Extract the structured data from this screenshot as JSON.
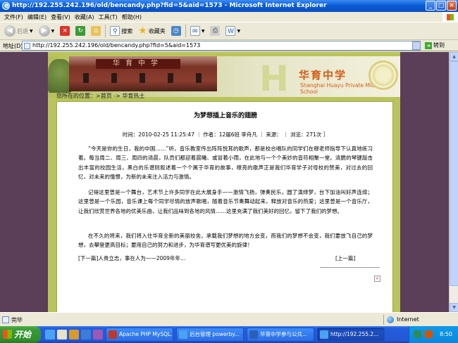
{
  "window": {
    "title": "http://192.255.242.196/old/bencandy.php?fid=5&aid=1573 - Microsoft Internet Explorer"
  },
  "menu": [
    "文件(F)",
    "编辑(E)",
    "查看(V)",
    "收藏(A)",
    "工具(T)",
    "帮助(H)"
  ],
  "toolbar": {
    "back": "后退",
    "search": "搜索",
    "favorites": "收藏夹"
  },
  "address": {
    "label": "地址(D)",
    "url": "http://192.255.242.196/old/bencandy.php?fid=5&aid=1573",
    "go": "转到"
  },
  "site": {
    "school_cn": "华育中学",
    "school_en": "Shanghai Huayu Private Middle School",
    "building_sign": "华育中学",
    "breadcrumb": "您所在的位置：>首页 -> 华育热土"
  },
  "article": {
    "title": "为梦想插上音乐的翅膀",
    "meta": "时间：2010-02-25 11:25:47 ｜ 作者：12届6班 李舟凡 ｜ 来源： ｜ 浏览：271次 ］",
    "paragraphs": [
      "“今天是你的生日，我的中国……”听，音乐教室传出阵阵悦耳的歌声，那是校合唱队的同学们在穆老师指导下认真地练习着。每当周二、周三、周四的清晨，队员们都迎着晨曦、或冒着小雨，在此地与一个个美妙的音符相聚一堂。清脆的琴键敲击出丰富的校园生活，黑白的乐谱则叙述着一个个属于华育的故事，嘹亮的歌声正是我们华育学子对母校的赞美，对过去的回忆，对未来的憧憬，为新的未来注入活力与激情。",
      "记得这里曾是一个舞台，艺术节上许多同学在此大展身手——激情飞扬，弹奏民乐，圆了演绎梦，台下加油叫好声连绵；这里曾是一个乐园，音乐课上每个同学尽情的放声歌唱，随着音乐节奏舞动起来，释放对音乐的热爱；这里曾是一个音乐厅，让我们欣赏世界各地的优美乐曲，让我们品味到各地的风情……这里充满了我们美好的回忆，留下了我们的梦想。",
      "在不久的将来，我们将入住华育全新的美丽校舍。承载我们梦想的地方会变，而我们的梦想不会变，我们要放飞自己的梦想，去攀登更高目标；要用自己的努力和进步，为华育谱写更优美的旋律！"
    ],
    "prev": "[下一篇]人贵立志，事在人为——2009年年…",
    "next": "[上一篇]"
  },
  "status": {
    "text": "完毕",
    "zone": "Internet"
  },
  "taskbar": {
    "start": "开始",
    "tasks": [
      "Apache PHP MySQL...",
      "后台管理 powerby...",
      "华育中学参与公共...",
      "http://192.255.2..."
    ],
    "clock": "8:50"
  }
}
